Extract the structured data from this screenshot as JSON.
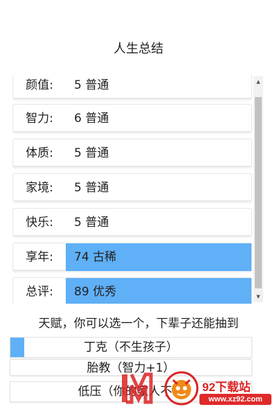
{
  "title": "人生总结",
  "stats": [
    {
      "label": "颜值:",
      "value": "5 普通",
      "highlighted": false
    },
    {
      "label": "智力:",
      "value": "6 普通",
      "highlighted": false
    },
    {
      "label": "体质:",
      "value": "5 普通",
      "highlighted": false
    },
    {
      "label": "家境:",
      "value": "5 普通",
      "highlighted": false
    },
    {
      "label": "快乐:",
      "value": "5 普通",
      "highlighted": false
    },
    {
      "label": "享年:",
      "value": "74 古稀",
      "highlighted": true
    },
    {
      "label": "总评:",
      "value": "89 优秀",
      "highlighted": true
    }
  ],
  "talent_prompt": "天赋，你可以选一个，下辈子还能抽到",
  "talent_options": [
    {
      "label": "丁克（不生孩子）"
    },
    {
      "label": "胎教（智力+1）"
    },
    {
      "label": "低压（你的家人不会"
    }
  ],
  "watermark": {
    "brand": "92下载站",
    "url": "www.xz92.com"
  },
  "colors": {
    "highlight": "#5fb0f7",
    "watermark_red": "#d92525"
  }
}
